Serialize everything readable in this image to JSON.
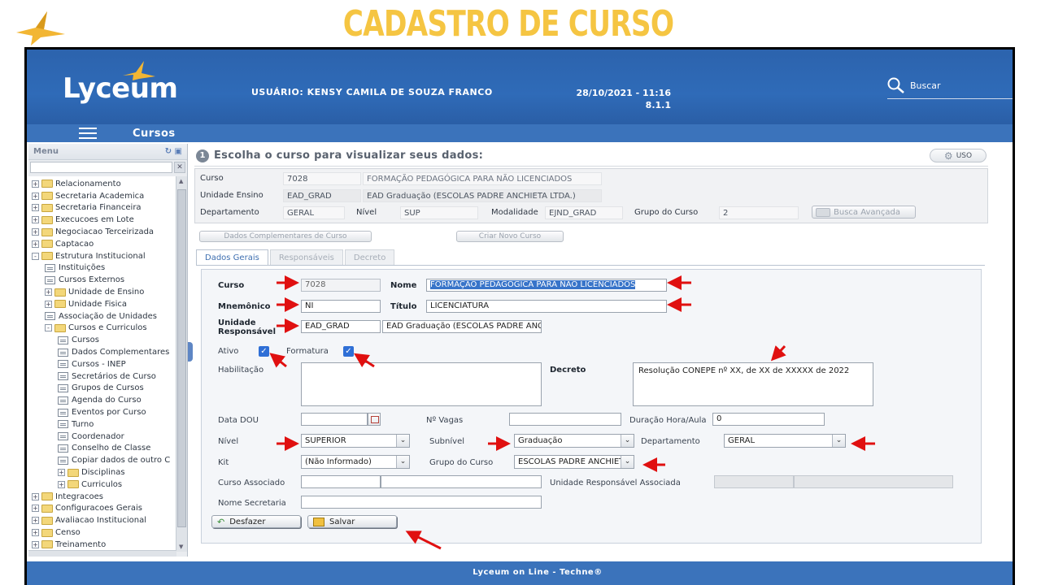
{
  "slide": {
    "title": "CADASTRO DE CURSO"
  },
  "app": {
    "logo": "Lyceum",
    "user": "USUÁRIO: KENSY CAMILA DE SOUZA FRANCO",
    "datetime": "28/10/2021 - 11:16",
    "version": "8.1.1",
    "search_label": "Buscar",
    "section_title": "Cursos",
    "footer": "Lyceum on Line - Techne®"
  },
  "sidebar": {
    "header": "Menu",
    "items": [
      {
        "label": "Relacionamento",
        "kind": "folder",
        "level": 0,
        "toggle": "+"
      },
      {
        "label": "Secretaria Academica",
        "kind": "folder",
        "level": 0,
        "toggle": "+"
      },
      {
        "label": "Secretaria Financeira",
        "kind": "folder",
        "level": 0,
        "toggle": "+"
      },
      {
        "label": "Execucoes em Lote",
        "kind": "folder",
        "level": 0,
        "toggle": "+"
      },
      {
        "label": "Negociacao Terceirizada",
        "kind": "folder",
        "level": 0,
        "toggle": "+"
      },
      {
        "label": "Captacao",
        "kind": "folder",
        "level": 0,
        "toggle": "+"
      },
      {
        "label": "Estrutura Institucional",
        "kind": "folder",
        "level": 0,
        "toggle": "-"
      },
      {
        "label": "Instituições",
        "kind": "doc",
        "level": 1
      },
      {
        "label": "Cursos Externos",
        "kind": "doc",
        "level": 1
      },
      {
        "label": "Unidade de Ensino",
        "kind": "folder",
        "level": 1,
        "toggle": "+"
      },
      {
        "label": "Unidade Fisica",
        "kind": "folder",
        "level": 1,
        "toggle": "+"
      },
      {
        "label": "Associação de Unidades",
        "kind": "doc",
        "level": 1
      },
      {
        "label": "Cursos e Curriculos",
        "kind": "folder",
        "level": 1,
        "toggle": "-"
      },
      {
        "label": "Cursos",
        "kind": "doc",
        "level": 2
      },
      {
        "label": "Dados Complementares",
        "kind": "doc",
        "level": 2
      },
      {
        "label": "Cursos - INEP",
        "kind": "doc",
        "level": 2
      },
      {
        "label": "Secretários de Curso",
        "kind": "doc",
        "level": 2
      },
      {
        "label": "Grupos de Cursos",
        "kind": "doc",
        "level": 2
      },
      {
        "label": "Agenda do Curso",
        "kind": "doc",
        "level": 2
      },
      {
        "label": "Eventos por Curso",
        "kind": "doc",
        "level": 2
      },
      {
        "label": "Turno",
        "kind": "doc",
        "level": 2
      },
      {
        "label": "Coordenador",
        "kind": "doc",
        "level": 2
      },
      {
        "label": "Conselho de Classe",
        "kind": "doc",
        "level": 2
      },
      {
        "label": "Copiar dados de outro C",
        "kind": "doc",
        "level": 2
      },
      {
        "label": "Disciplinas",
        "kind": "folder",
        "level": 2,
        "toggle": "+"
      },
      {
        "label": "Curriculos",
        "kind": "folder",
        "level": 2,
        "toggle": "+"
      },
      {
        "label": "Integracoes",
        "kind": "folder",
        "level": 0,
        "toggle": "+"
      },
      {
        "label": "Configuracoes Gerais",
        "kind": "folder",
        "level": 0,
        "toggle": "+"
      },
      {
        "label": "Avaliacao Institucional",
        "kind": "folder",
        "level": 0,
        "toggle": "+"
      },
      {
        "label": "Censo",
        "kind": "folder",
        "level": 0,
        "toggle": "+"
      },
      {
        "label": "Treinamento",
        "kind": "folder",
        "level": 0,
        "toggle": "+"
      }
    ]
  },
  "choose": {
    "step": "1",
    "title": "Escolha o curso para visualizar seus dados:",
    "uso": "USO"
  },
  "summary": {
    "curso_label": "Curso",
    "curso_code": "7028",
    "curso_name": "FORMAÇÃO PEDAGÓGICA PARA NÃO LICENCIADOS",
    "unidade_label": "Unidade Ensino",
    "unidade_code": "EAD_GRAD",
    "unidade_name": "EAD Graduação (ESCOLAS PADRE ANCHIETA LTDA.)",
    "depto_label": "Departamento",
    "depto_value": "GERAL",
    "nivel_label": "Nível",
    "nivel_value": "SUP",
    "modalidade_label": "Modalidade",
    "modalidade_value": "EJND_GRAD",
    "grupo_label": "Grupo do Curso",
    "grupo_value": "2",
    "busca_btn": "Busca Avançada"
  },
  "buttons": {
    "dados_complementares": "Dados Complementares de Curso",
    "criar_novo": "Criar Novo Curso",
    "desfazer": "Desfazer",
    "salvar": "Salvar"
  },
  "tabs": [
    "Dados Gerais",
    "Responsáveis",
    "Decreto"
  ],
  "form": {
    "curso_label": "Curso",
    "curso_value": "7028",
    "nome_label": "Nome",
    "nome_value": "FORMAÇÃO PEDAGÓGICA PARA NÃO LICENCIADOS",
    "mnemonico_label": "Mnemônico",
    "mnemonico_value": "NI",
    "titulo_label": "Título",
    "titulo_value": "LICENCIATURA",
    "unidade_label_1": "Unidade",
    "unidade_label_2": "Responsável",
    "unidade_code": "EAD_GRAD",
    "unidade_name": "EAD Graduação (ESCOLAS PADRE ANCHIETA LTDA.)",
    "ativo_label": "Ativo",
    "formatura_label": "Formatura",
    "habilitacao_label": "Habilitação",
    "habilitacao_value": "",
    "decreto_label": "Decreto",
    "decreto_value": "Resolução CONEPE nº XX, de XX de XXXXX de 2022",
    "data_dou_label": "Data DOU",
    "data_dou_value": "",
    "vagas_label": "Nº Vagas",
    "vagas_value": "",
    "duracao_label": "Duração Hora/Aula",
    "duracao_value": "0",
    "nivel_label": "Nível",
    "nivel_value": "SUPERIOR",
    "subnivel_label": "Subnível",
    "subnivel_value": "Graduação",
    "departamento_label": "Departamento",
    "departamento_value": "GERAL",
    "kit_label": "Kit",
    "kit_value": "(Não Informado)",
    "grupo_label": "Grupo do Curso",
    "grupo_value": "ESCOLAS PADRE ANCHIETA",
    "curso_assoc_label": "Curso Associado",
    "unidade_assoc_label": "Unidade Responsável Associada",
    "nome_secretaria_label": "Nome Secretaria",
    "nome_secretaria_value": ""
  },
  "colors": {
    "header_blue": "#2f6bb8",
    "accent_yellow": "#f5c542",
    "arrow_red": "#e01010",
    "checkbox_blue": "#2f6fd6"
  }
}
